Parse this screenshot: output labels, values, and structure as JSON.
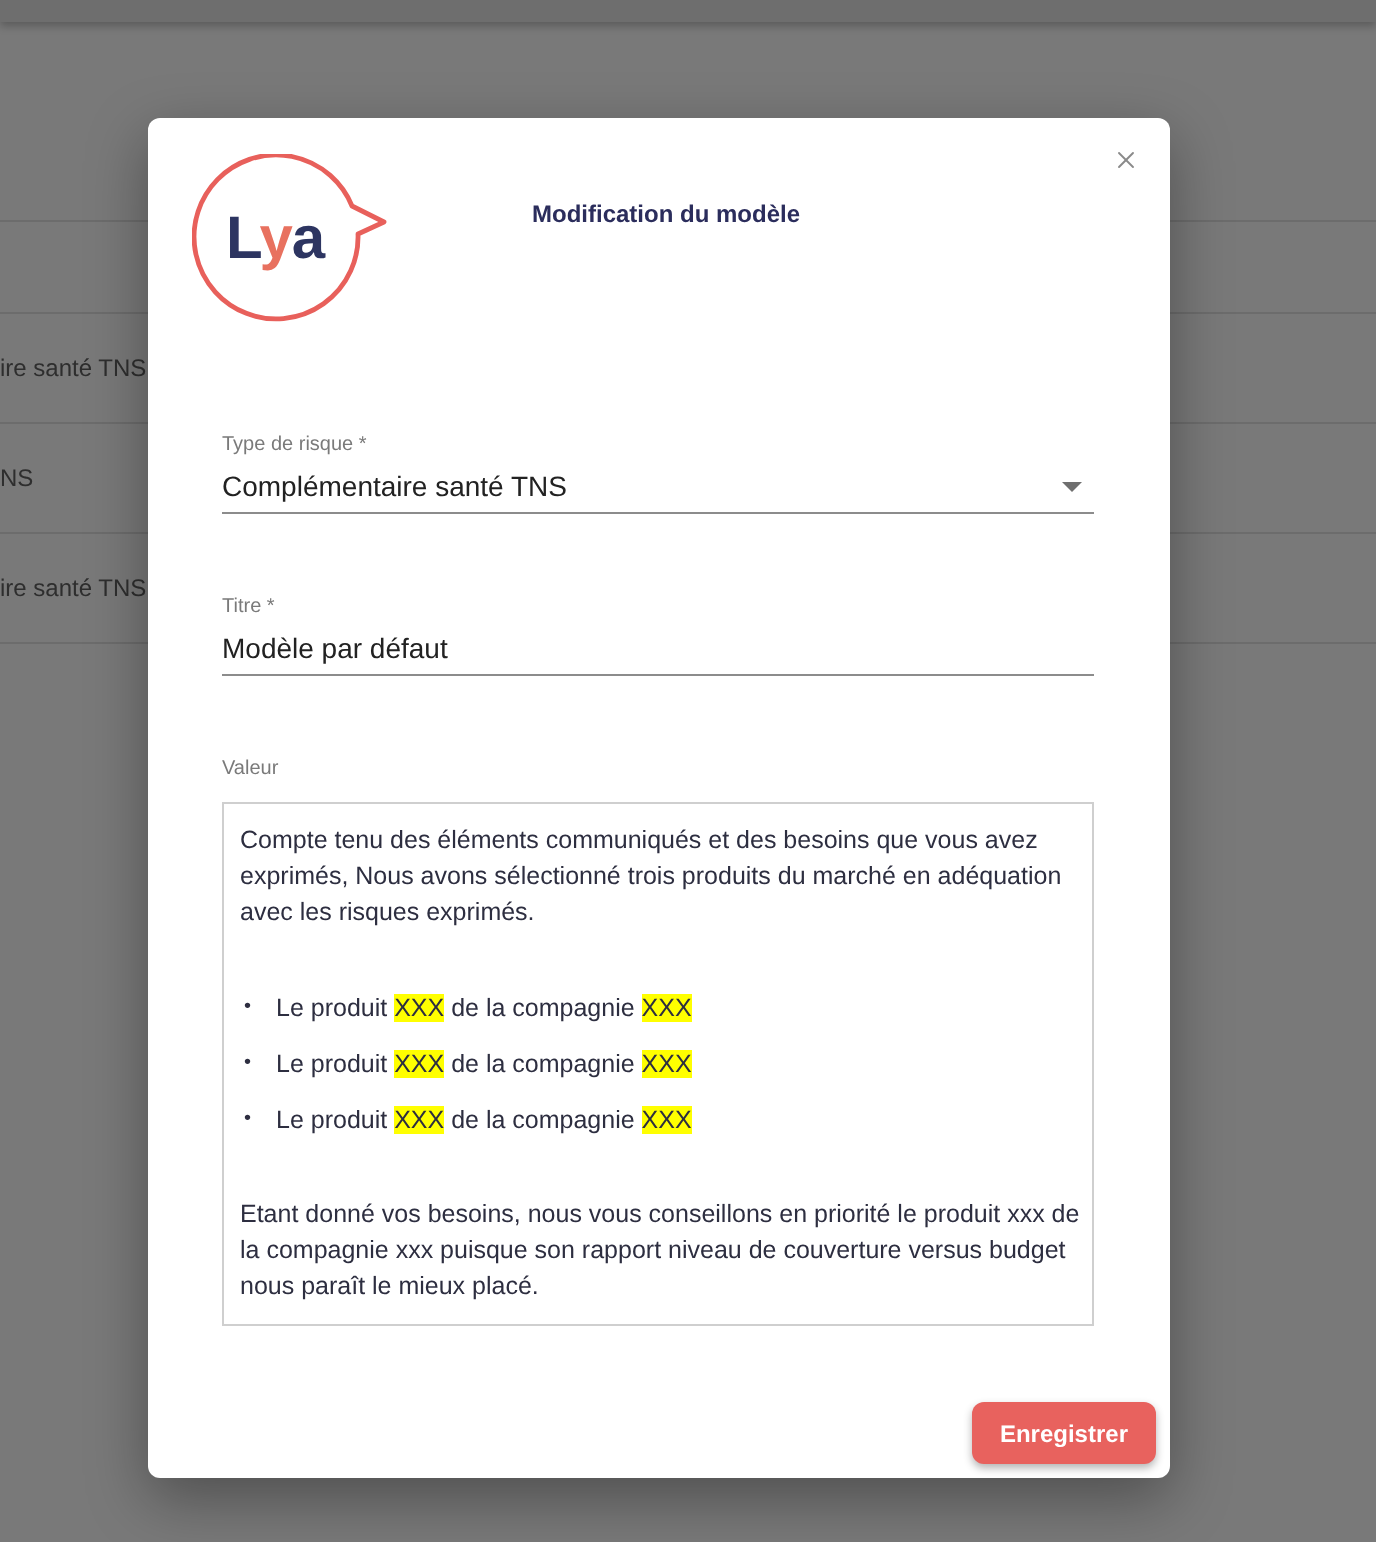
{
  "background_table": {
    "rows": [
      {
        "cell": "ire santé TNS"
      },
      {
        "cell": "NS"
      },
      {
        "cell": "ire santé TNS"
      }
    ]
  },
  "dialog": {
    "logo": {
      "parts": [
        {
          "text": "L",
          "accent": false
        },
        {
          "text": "y",
          "accent": true
        },
        {
          "text": "a",
          "accent": false
        }
      ]
    },
    "title": "Modification du modèle",
    "fields": [
      {
        "kind": "select",
        "label": "Type de risque *",
        "value": "Complémentaire santé TNS"
      },
      {
        "kind": "text",
        "label": "Titre *",
        "value": "Modèle par défaut"
      }
    ],
    "editor": {
      "label": "Valeur",
      "blocks": [
        {
          "kind": "paragraph",
          "text": "Compte tenu des éléments communiqués et des besoins que vous avez exprimés, Nous avons sélectionné trois produits du marché en adéquation avec les risques exprimés."
        },
        {
          "kind": "list",
          "items": [
            {
              "marker": "•",
              "segments": [
                {
                  "text": "Le produit ",
                  "highlighted": false
                },
                {
                  "text": "XXX",
                  "highlighted": true
                },
                {
                  "text": " de la compagnie ",
                  "highlighted": false
                },
                {
                  "text": "XXX",
                  "highlighted": true
                }
              ]
            },
            {
              "marker": "•",
              "segments": [
                {
                  "text": "Le produit ",
                  "highlighted": false
                },
                {
                  "text": "XXX",
                  "highlighted": true
                },
                {
                  "text": " de la compagnie ",
                  "highlighted": false
                },
                {
                  "text": "XXX",
                  "highlighted": true
                }
              ]
            },
            {
              "marker": "•",
              "segments": [
                {
                  "text": "Le produit ",
                  "highlighted": false
                },
                {
                  "text": "XXX",
                  "highlighted": true
                },
                {
                  "text": " de la compagnie ",
                  "highlighted": false
                },
                {
                  "text": "XXX",
                  "highlighted": true
                }
              ]
            }
          ]
        },
        {
          "kind": "paragraph",
          "text": "Etant donné vos besoins, nous vous conseillons en priorité le produit xxx de la compagnie xxx puisque son rapport niveau de couverture versus budget nous paraît le mieux placé."
        }
      ]
    },
    "buttons": [
      {
        "label": "Enregistrer"
      }
    ]
  }
}
